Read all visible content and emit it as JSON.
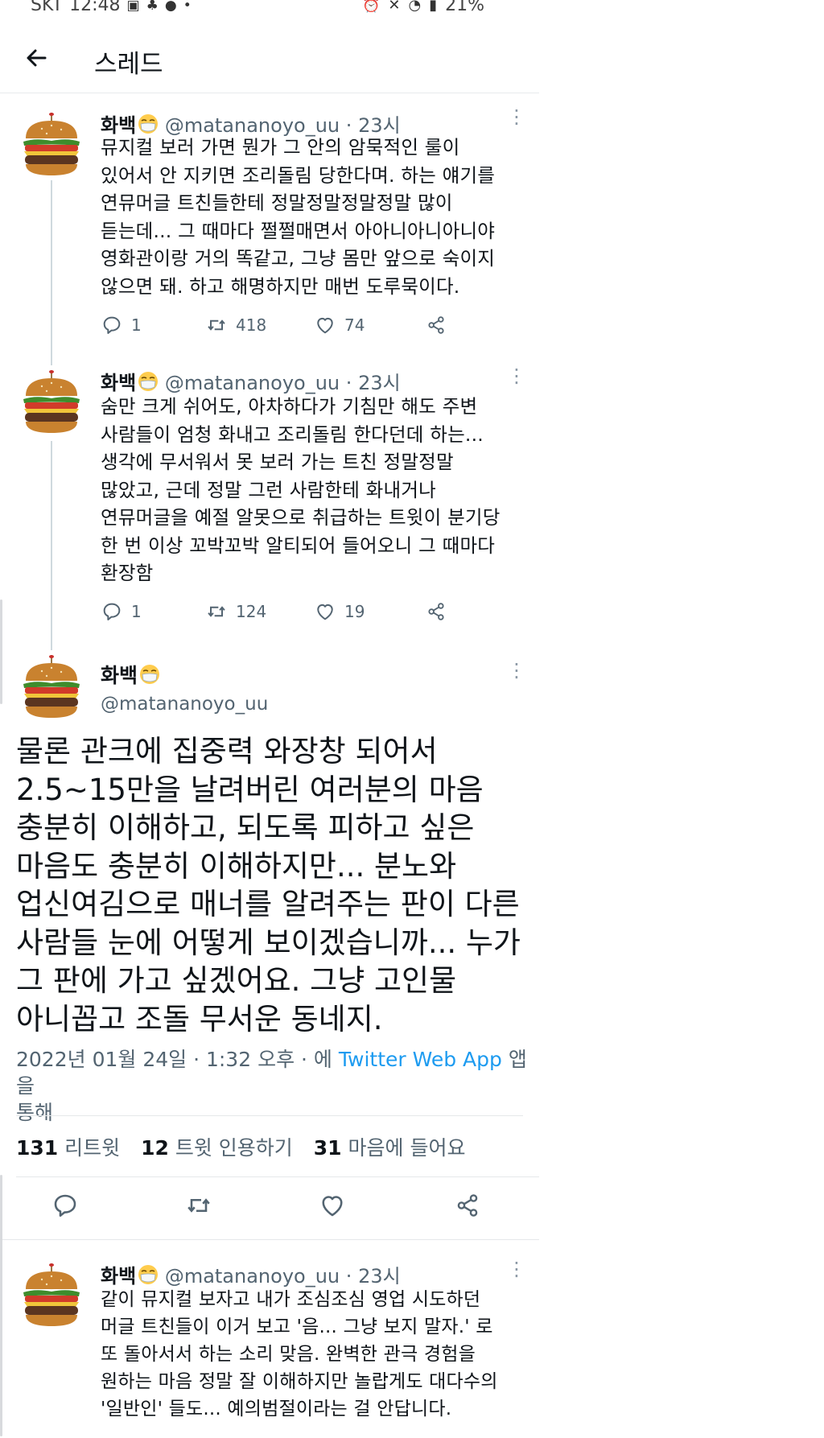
{
  "status_bar": {
    "carrier": "SKT",
    "time": "12:48",
    "battery": "21%"
  },
  "header": {
    "title": "스레드"
  },
  "tweets_before": [
    {
      "name": "화백",
      "handle": "@matananoyo_uu",
      "dot": "·",
      "time": "23시",
      "text": "뮤지컬 보러 가면 뭔가 그 안의 암묵적인 룰이\n있어서 안 지키면 조리돌림 당한다며. 하는 얘기를\n연뮤머글 트친들한테 정말정말정말정말 많이\n듣는데... 그 때마다 쩔쩔매면서 아아니아니아니야\n영화관이랑 거의 똑같고, 그냥 몸만 앞으로 숙이지\n않으면 돼. 하고 해명하지만 매번 도루묵이다.",
      "replies": "1",
      "retweets": "418",
      "likes": "74"
    },
    {
      "name": "화백",
      "handle": "@matananoyo_uu",
      "dot": "·",
      "time": "23시",
      "text": "숨만 크게 쉬어도, 아차하다가 기침만 해도 주변\n사람들이 엄청 화내고 조리돌림 한다던데 하는...\n생각에 무서워서 못 보러 가는 트친 정말정말\n많았고, 근데 정말 그런 사람한테 화내거나\n연뮤머글을 예절 알못으로 취급하는 트윗이 분기당\n한 번 이상 꼬박꼬박 알티되어 들어오니 그 때마다\n환장함",
      "replies": "1",
      "retweets": "124",
      "likes": "19"
    }
  ],
  "main_tweet": {
    "name": "화백",
    "handle": "@matananoyo_uu",
    "text": "물론 관크에 집중력 와장창 되어서\n2.5~15만을 날려버린 여러분의 마음\n충분히 이해하고, 되도록 피하고 싶은\n마음도 충분히 이해하지만... 분노와\n업신여김으로 매너를 알려주는 판이 다른\n사람들 눈에 어떻게 보이겠습니까... 누가\n그 판에 가고 싶겠어요. 그냥 고인물\n아니꼽고 조돌 무서운 동네지.",
    "date": "2022년 01월 24일 · 1:32 오후 · 에",
    "via": "Twitter Web App",
    "via_suffix": "앱을",
    "via_suffix2": "통해",
    "retweets_count": "131",
    "retweets_label": "리트윗",
    "quotes_count": "12",
    "quotes_label": "트윗 인용하기",
    "likes_count": "31",
    "likes_label": "마음에 들어요"
  },
  "tweets_after": [
    {
      "name": "화백",
      "handle": "@matananoyo_uu",
      "dot": "·",
      "time": "23시",
      "text": "같이 뮤지컬 보자고 내가 조심조심 영업 시도하던\n머글 트친들이 이거 보고 '음... 그냥 보지 말자.' 로\n또 돌아서서 하는 소리 맞음. 완벽한 관극 경험을\n원하는 마음 정말 잘 이해하지만 놀랍게도 대다수의\n'일반인' 들도... 예의범절이라는 걸 안답니다."
    }
  ],
  "icons": {
    "back": "arrow-left-icon",
    "reply": "speech-bubble-icon",
    "retweet": "retweet-icon",
    "like": "heart-icon",
    "share": "share-icon",
    "more": "more-vertical-icon",
    "mask": "face-mask-emoji"
  },
  "colors": {
    "link": "#1d9bf0",
    "secondary_text": "#536471",
    "text": "#0f1419"
  }
}
